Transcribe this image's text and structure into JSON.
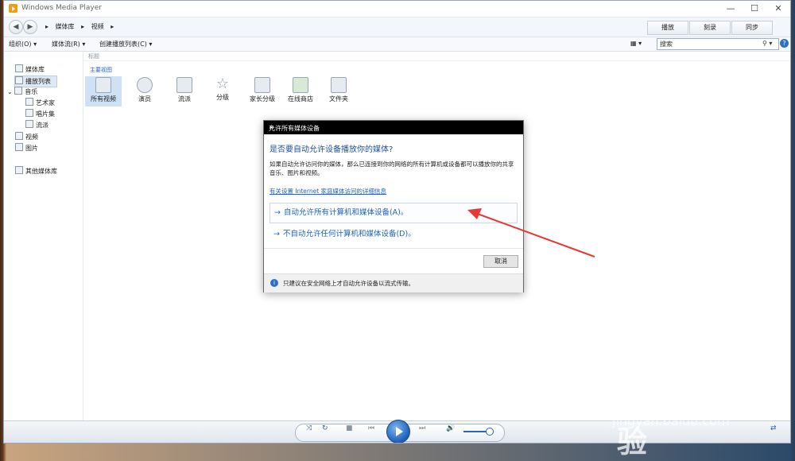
{
  "app": {
    "title": "Windows Media Player",
    "min": "—",
    "max": "☐",
    "close": "✕"
  },
  "nav": {
    "back": "◀",
    "forward": "▶",
    "breadcrumb": [
      "媒体库",
      "视频"
    ],
    "sep": "▸"
  },
  "tabs": [
    "播放",
    "刻录",
    "同步"
  ],
  "toolbar": {
    "organize": "组织(O)",
    "stream": "媒体流(R)",
    "create_playlist": "创建播放列表(C)",
    "search_placeholder": "搜索",
    "search_icon": "search-icon",
    "help": "?"
  },
  "sidebar": {
    "items": [
      "媒体库",
      "播放列表",
      "音乐",
      "艺术家",
      "唱片集",
      "流派",
      "视频",
      "图片",
      "其他媒体库"
    ]
  },
  "content": {
    "column_header": "标题",
    "section_title": "主要视图",
    "tiles": [
      "所有视频",
      "演员",
      "流派",
      "分级",
      "家长分级",
      "在线商店",
      "文件夹"
    ]
  },
  "controls": {
    "shuffle": "⤨",
    "repeat": "↻",
    "stop": "■",
    "prev": "⏮",
    "next": "⏭",
    "volume": "🔊",
    "switch": "⇄"
  },
  "dialog": {
    "title": "允许所有媒体设备",
    "close": "✕",
    "question": "是否要自动允许设备播放你的媒体?",
    "body": "如果自动允许访问你的媒体，那么已连接到你的网络的所有计算机或设备都可以播放你的共享音乐、图片和视频。",
    "link": "有关设置 Internet 家庭媒体访问的详细信息",
    "option1": "自动允许所有计算机和媒体设备(A)。",
    "option2": "不自动允许任何计算机和媒体设备(D)。",
    "option_arrow": "→",
    "cancel": "取消",
    "footer": "只建议在安全网络上才自动允许设备以流式传输。"
  },
  "watermark": {
    "brand": "Bai du 经验",
    "url": "jingyan.baidu.com"
  },
  "colors": {
    "accent": "#1e63c2",
    "annotation_arrow": "#e53935",
    "dialog_title_bg": "#000000"
  }
}
